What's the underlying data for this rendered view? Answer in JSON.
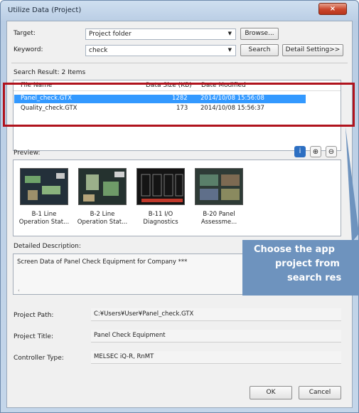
{
  "window": {
    "title": "Utilize Data (Project)",
    "close_glyph": "×"
  },
  "target": {
    "label": "Target:",
    "value": "Project folder",
    "browse_label": "Browse..."
  },
  "keyword": {
    "label": "Keyword:",
    "value": "check",
    "search_label": "Search",
    "detail_label": "Detail Setting>>"
  },
  "results": {
    "title": "Search Result: 2 Items",
    "columns": [
      "File Name",
      "Data Size (KB)",
      "Date Modified"
    ],
    "rows": [
      {
        "name": "Panel_check.GTX",
        "size": "1282",
        "date": "2014/10/08 15:56:08",
        "selected": true
      },
      {
        "name": "Quality_check.GTX",
        "size": "173",
        "date": "2014/10/08 15:56:37",
        "selected": false
      }
    ]
  },
  "preview": {
    "title": "Preview:",
    "icons": [
      "info-icon",
      "zoom-in-icon",
      "zoom-out-icon"
    ],
    "thumbnails": [
      {
        "line1": "B-1 Line",
        "line2": "Operation Stat..."
      },
      {
        "line1": "B-2 Line",
        "line2": "Operation Stat..."
      },
      {
        "line1": "B-11 I/O",
        "line2": "Diagnostics"
      },
      {
        "line1": "B-20 Panel",
        "line2": "Assessme..."
      }
    ]
  },
  "description": {
    "title": "Detailed Description:",
    "text": "Screen Data of Panel Check Equipment for Company ***"
  },
  "details": {
    "path_label": "Project Path:",
    "path_value": "C:¥Users¥User¥Panel_check.GTX",
    "title_label": "Project Title:",
    "title_value": "Panel Check Equipment",
    "controller_label": "Controller Type:",
    "controller_value": "MELSEC iQ-R, RnMT"
  },
  "buttons": {
    "ok": "OK",
    "cancel": "Cancel"
  },
  "callout": {
    "line1": "Choose the app",
    "line2": "project from",
    "line3": "search res"
  },
  "colors": {
    "selection": "#3399ff",
    "highlight_box": "#b0131d",
    "callout": "#6e93be"
  }
}
